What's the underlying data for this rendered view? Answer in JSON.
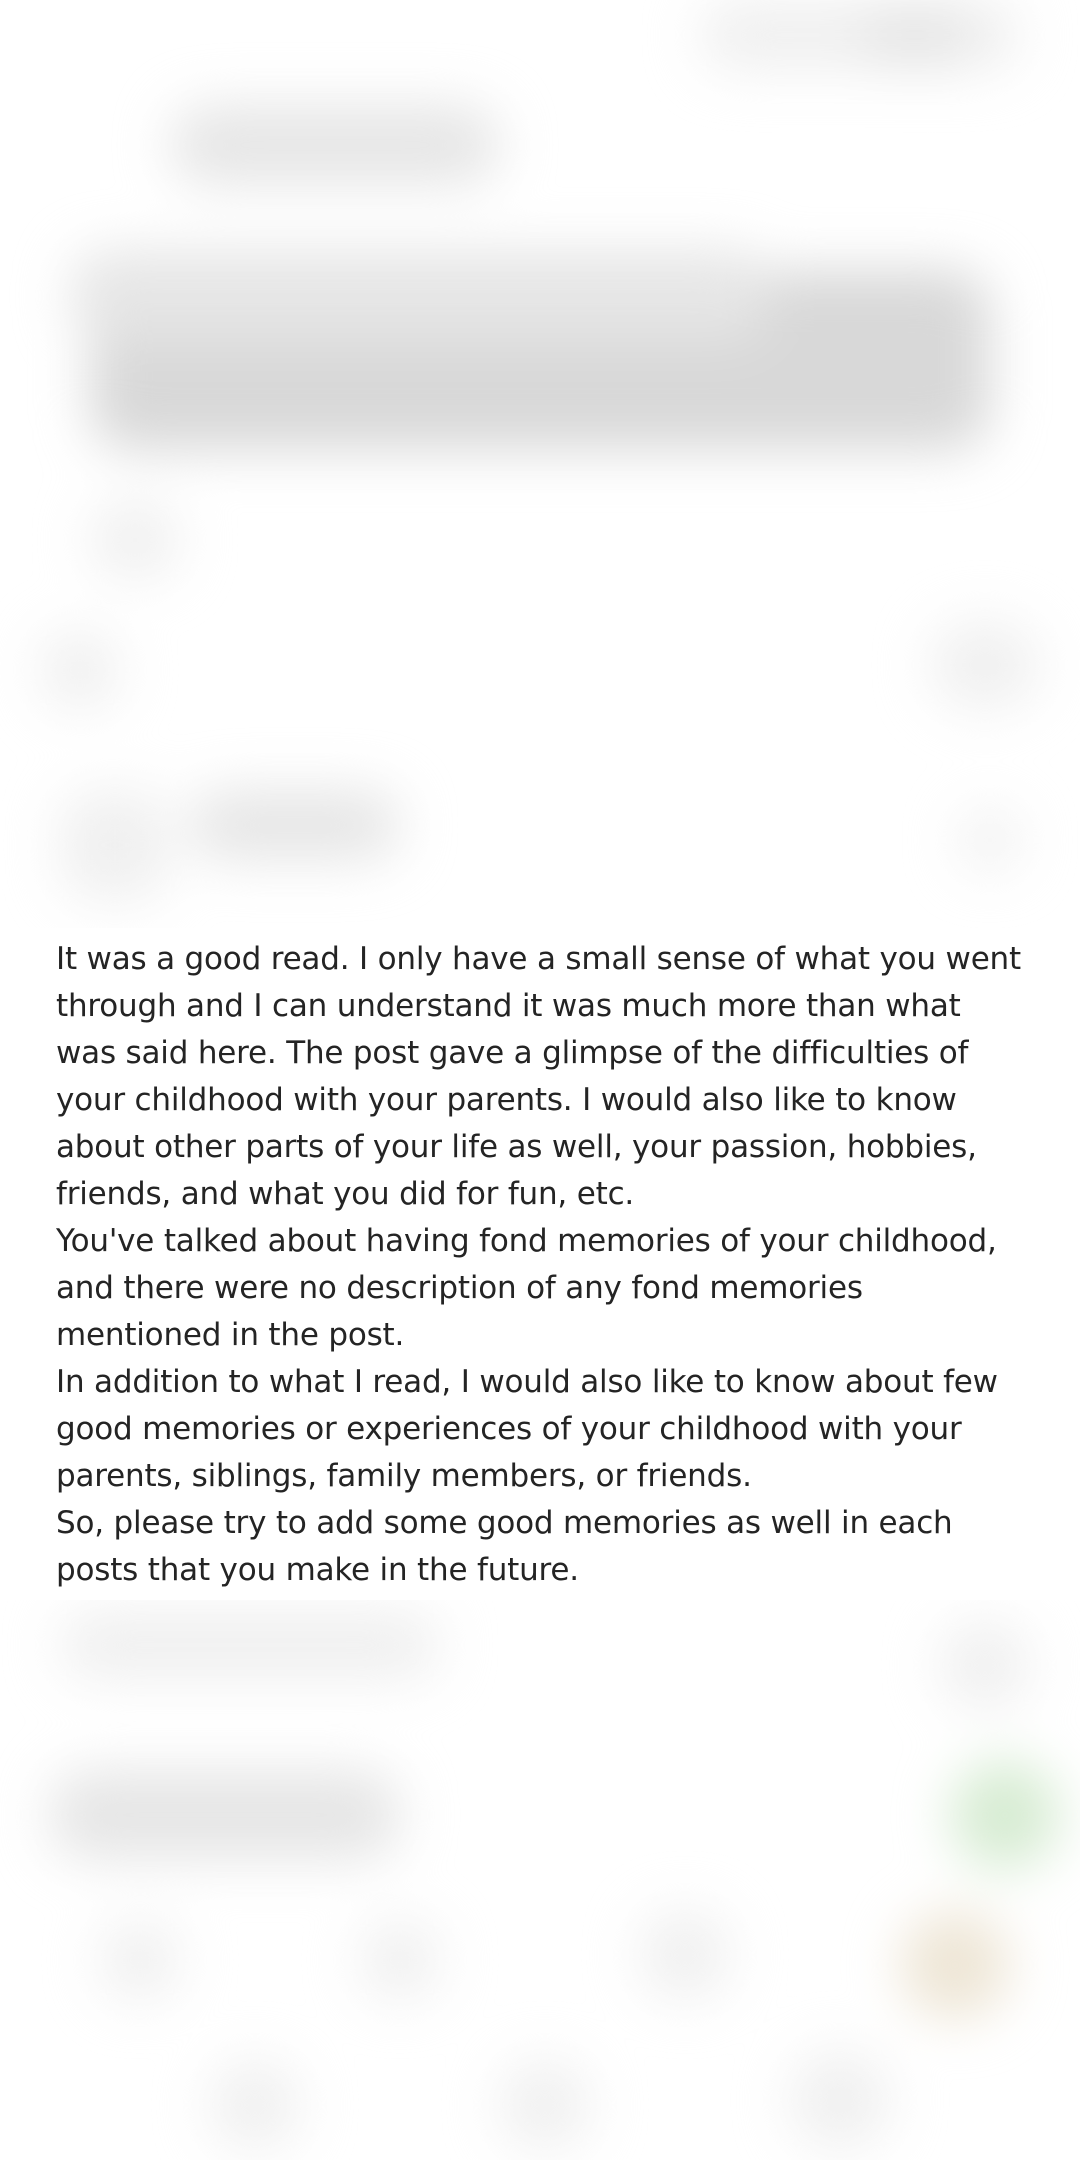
{
  "comment": {
    "paragraphs": [
      "It was a good read. I only have a small sense of what you went through and I can understand it was much more than what was said here. The post gave a glimpse of the difficulties of your childhood with your parents. I would also like to know about other parts of your life as well, your passion, hobbies, friends, and what you did for fun, etc.",
      "You've talked about having fond memories of your childhood, and there were no description of any fond memories mentioned in the post.",
      "In addition to what I read, I would also like to know about few good memories or experiences of your childhood with your parents, siblings, family members, or friends.",
      "So, please try to add some good memories as well in each posts that you make in the future."
    ]
  },
  "colors": {
    "background": "#ffffff",
    "text": "#242424",
    "accent": "#1a8917"
  }
}
